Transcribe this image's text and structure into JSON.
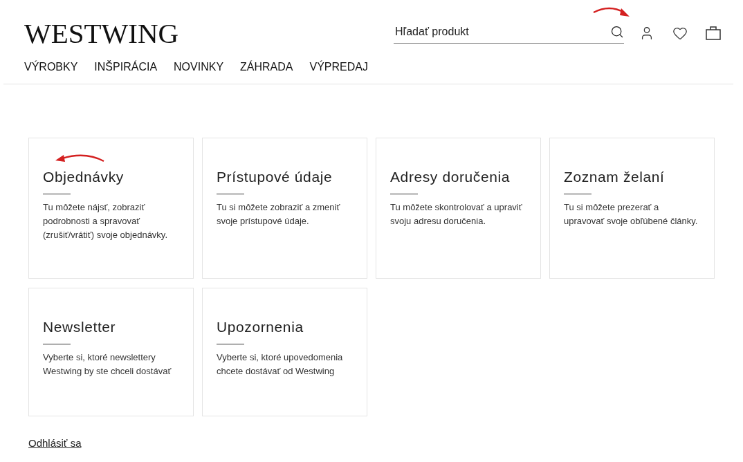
{
  "header": {
    "logo": "WESTWING",
    "search": {
      "placeholder": "Hľadať produkt"
    }
  },
  "nav": [
    "VÝROBKY",
    "INŠPIRÁCIA",
    "NOVINKY",
    "ZÁHRADA",
    "VÝPREDAJ"
  ],
  "cards": [
    {
      "title": "Objednávky",
      "description": "Tu môžete nájsť, zobraziť podrobnosti a spravovať (zrušiť/vrátiť) svoje objednávky."
    },
    {
      "title": "Prístupové údaje",
      "description": "Tu si môžete zobraziť a zmeniť svoje prístupové údaje."
    },
    {
      "title": "Adresy doručenia",
      "description": "Tu môžete skontrolovať a upraviť svoju adresu doručenia."
    },
    {
      "title": "Zoznam želaní",
      "description": "Tu si môžete prezerať a upravovať svoje obľúbené články."
    },
    {
      "title": "Newsletter",
      "description": "Vyberte si, ktoré newslettery Westwing by ste chceli dostávať"
    },
    {
      "title": "Upozornenia",
      "description": "Vyberte si, ktoré upovedomenia chcete dostávať od Westwing"
    }
  ],
  "logout": "Odhlásiť sa"
}
